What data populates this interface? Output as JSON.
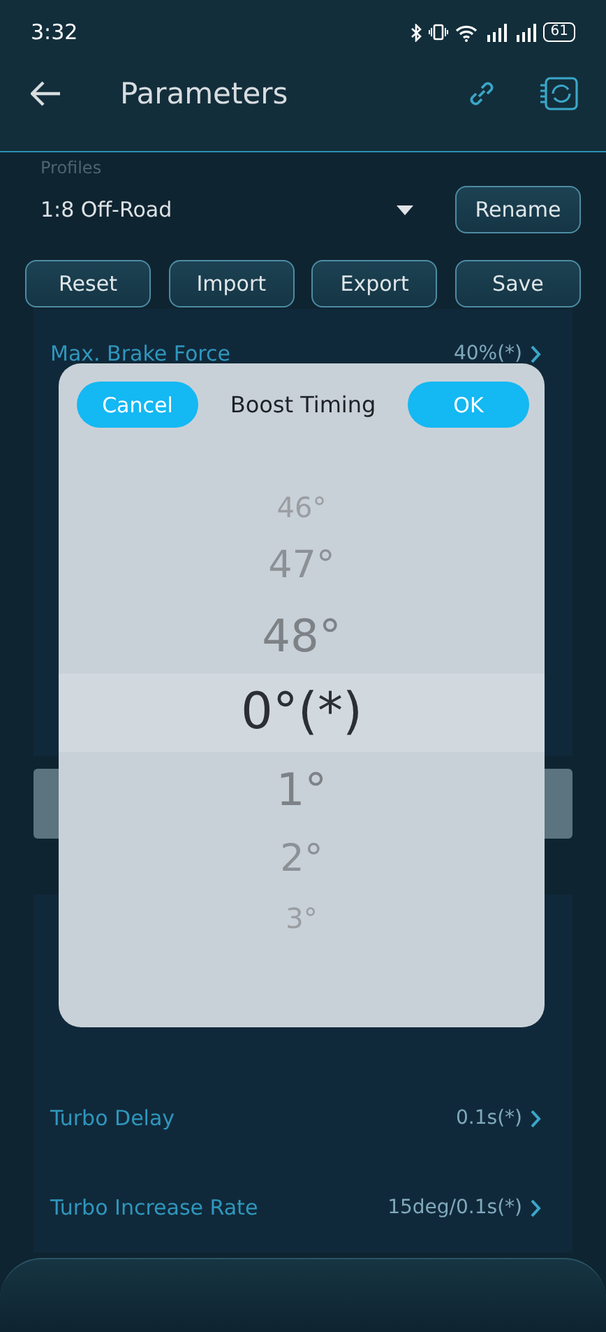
{
  "status_bar": {
    "time": "3:32",
    "battery": "61"
  },
  "header": {
    "title": "Parameters"
  },
  "profiles": {
    "label": "Profiles",
    "value": "1:8 Off-Road",
    "rename": "Rename"
  },
  "actions": [
    "Reset",
    "Import",
    "Export",
    "Save"
  ],
  "rows": [
    {
      "kind": "row",
      "label": "Max. Brake Force",
      "value": "40%(*)"
    },
    {
      "kind": "row"
    },
    {
      "kind": "row"
    },
    {
      "kind": "row"
    },
    {
      "kind": "row"
    },
    {
      "kind": "highlight"
    },
    {
      "kind": "header"
    },
    {
      "kind": "row"
    },
    {
      "kind": "row"
    },
    {
      "kind": "row",
      "label": "Turbo Delay",
      "value": "0.1s(*)"
    },
    {
      "kind": "row",
      "label": "Turbo Increase Rate",
      "value": "15deg/0.1s(*)"
    }
  ],
  "dialog": {
    "title": "Boost Timing",
    "cancel": "Cancel",
    "ok": "OK",
    "options": [
      {
        "label": "46°",
        "selected": false
      },
      {
        "label": "47°",
        "selected": false
      },
      {
        "label": "48°",
        "selected": false
      },
      {
        "label": "0°(*)",
        "selected": true
      },
      {
        "label": "1°",
        "selected": false
      },
      {
        "label": "2°",
        "selected": false
      },
      {
        "label": "3°",
        "selected": false
      }
    ]
  }
}
